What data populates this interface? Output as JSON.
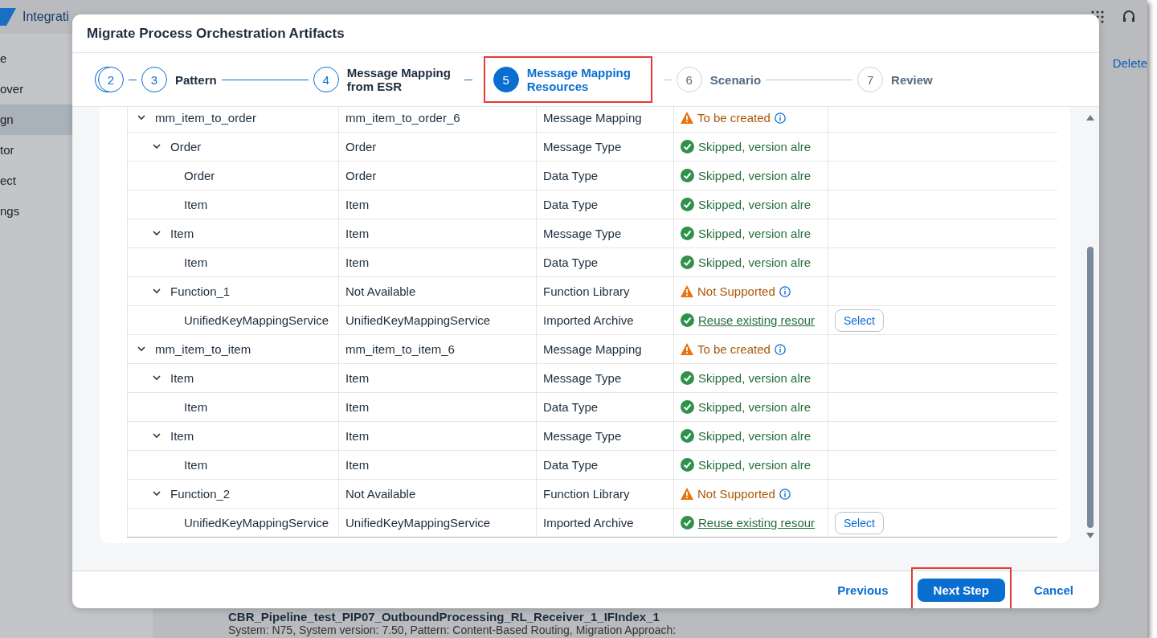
{
  "app": {
    "title": "Integrati",
    "side_items": [
      {
        "label": "e",
        "selected": false
      },
      {
        "label": "over",
        "selected": false
      },
      {
        "label": "gn",
        "selected": true
      },
      {
        "label": "tor",
        "selected": false
      },
      {
        "label": "ect",
        "selected": false
      },
      {
        "label": "ngs",
        "selected": false
      }
    ],
    "delete": "Delete",
    "artifact_title": "CBR_Pipeline_test_PIP07_OutboundProcessing_RL_Receiver_1_IFIndex_1",
    "artifact_meta": "System: N75, System version: 7.50, Pattern: Content-Based Routing, Migration Approach:"
  },
  "dialog": {
    "title": "Migrate Process Orchestration Artifacts",
    "steps": [
      {
        "number": "2",
        "completed": true,
        "selected": false,
        "stacked": true
      },
      {
        "number": "3",
        "label": "Pattern",
        "completed": true,
        "selected": false
      },
      {
        "number": "4",
        "label": "Message Mapping from ESR",
        "completed": true,
        "selected": false
      },
      {
        "number": "5",
        "label": "Message Mapping Resources",
        "completed": true,
        "selected": true
      },
      {
        "number": "6",
        "label": "Scenario",
        "completed": false,
        "selected": false
      },
      {
        "number": "7",
        "label": "Review",
        "completed": false,
        "selected": false
      }
    ],
    "rows": [
      {
        "name": "mm_item_to_order",
        "technical": "mm_item_to_order_6",
        "type": "Message Mapping",
        "status": {
          "kind": "warning",
          "text": "To be created",
          "info": true
        },
        "expanded": true,
        "children": [
          {
            "name": "Order",
            "technical": "Order",
            "type": "Message Type",
            "status": {
              "kind": "success",
              "text": "Skipped, version alre"
            },
            "expanded": true,
            "children": [
              {
                "name": "Order",
                "technical": "Order",
                "type": "Data Type",
                "status": {
                  "kind": "success",
                  "text": "Skipped, version alre"
                }
              },
              {
                "name": "Item",
                "technical": "Item",
                "type": "Data Type",
                "status": {
                  "kind": "success",
                  "text": "Skipped, version alre"
                }
              }
            ]
          },
          {
            "name": "Item",
            "technical": "Item",
            "type": "Message Type",
            "status": {
              "kind": "success",
              "text": "Skipped, version alre"
            },
            "expanded": true,
            "children": [
              {
                "name": "Item",
                "technical": "Item",
                "type": "Data Type",
                "status": {
                  "kind": "success",
                  "text": "Skipped, version alre"
                }
              }
            ]
          },
          {
            "name": "Function_1",
            "technical": "Not Available",
            "type": "Function Library",
            "status": {
              "kind": "warning",
              "text": "Not Supported",
              "info": true
            },
            "expanded": true,
            "children": [
              {
                "name": "UnifiedKeyMappingService",
                "technical": "UnifiedKeyMappingService",
                "type": "Imported Archive",
                "status": {
                  "kind": "reuse",
                  "text": "Reuse existing resour"
                },
                "action": "Select"
              }
            ]
          }
        ]
      },
      {
        "name": "mm_item_to_item",
        "technical": "mm_item_to_item_6",
        "type": "Message Mapping",
        "status": {
          "kind": "warning",
          "text": "To be created",
          "info": true
        },
        "expanded": true,
        "children": [
          {
            "name": "Item",
            "technical": "Item",
            "type": "Message Type",
            "status": {
              "kind": "success",
              "text": "Skipped, version alre"
            },
            "expanded": true,
            "children": [
              {
                "name": "Item",
                "technical": "Item",
                "type": "Data Type",
                "status": {
                  "kind": "success",
                  "text": "Skipped, version alre"
                }
              }
            ]
          },
          {
            "name": "Item",
            "technical": "Item",
            "type": "Message Type",
            "status": {
              "kind": "success",
              "text": "Skipped, version alre"
            },
            "expanded": true,
            "children": [
              {
                "name": "Item",
                "technical": "Item",
                "type": "Data Type",
                "status": {
                  "kind": "success",
                  "text": "Skipped, version alre"
                }
              }
            ]
          },
          {
            "name": "Function_2",
            "technical": "Not Available",
            "type": "Function Library",
            "status": {
              "kind": "warning",
              "text": "Not Supported",
              "info": true
            },
            "expanded": true,
            "children": [
              {
                "name": "UnifiedKeyMappingService",
                "technical": "UnifiedKeyMappingService",
                "type": "Imported Archive",
                "status": {
                  "kind": "reuse",
                  "text": "Reuse existing resour"
                },
                "action": "Select"
              }
            ]
          }
        ]
      }
    ],
    "footer": {
      "previous": "Previous",
      "next": "Next Step",
      "cancel": "Cancel"
    }
  }
}
